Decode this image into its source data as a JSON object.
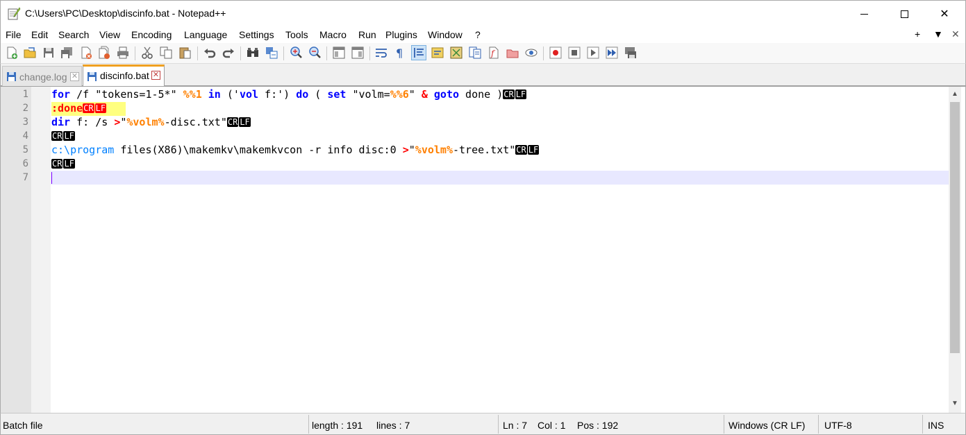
{
  "window": {
    "title": "C:\\Users\\PC\\Desktop\\discinfo.bat - Notepad++",
    "minimize": "minimize-icon",
    "maximize": "maximize-icon",
    "close": "✕"
  },
  "menu": {
    "items": [
      "File",
      "Edit",
      "Search",
      "View",
      "Encoding",
      "Language",
      "Settings",
      "Tools",
      "Macro",
      "Run",
      "Plugins",
      "Window",
      "?"
    ],
    "right": [
      "+",
      "▼",
      "✕"
    ]
  },
  "tabs": [
    {
      "label": "change.log",
      "active": false
    },
    {
      "label": "discinfo.bat",
      "active": true
    }
  ],
  "tab_close_glyph": "✕",
  "editor": {
    "line_numbers": [
      "1",
      "2",
      "3",
      "4",
      "5",
      "6",
      "7"
    ],
    "eol_cr": "CR",
    "eol_lf": "LF",
    "line1": {
      "kw_for": "for",
      "t1": " /f \"tokens=1-5*\" ",
      "var1": "%%1",
      "sp1": " ",
      "kw_in": "in",
      "t2": " ('",
      "kw_vol": "vol",
      "t3": " f:') ",
      "kw_do": "do",
      "t4": " ( ",
      "kw_set": "set",
      "t5": " \"volm=",
      "var2": "%%6",
      "t6": "\" ",
      "op_amp": "&",
      "sp2": " ",
      "kw_goto": "goto",
      "t7": " done )"
    },
    "line2": {
      "label": ":done"
    },
    "line3": {
      "kw_dir": "dir",
      "t1": " f: /s ",
      "op_gt": ">",
      "t2": "\"",
      "var": "%volm%",
      "t3": "-disc.txt\""
    },
    "line5": {
      "path": "c:\\program",
      "t1": " files(X86)\\makemkv\\makemkvcon -r info disc:0 ",
      "op_gt": ">",
      "t2": "\"",
      "var": "%volm%",
      "t3": "-tree.txt\""
    }
  },
  "scrollbar": {
    "up": "▲",
    "down": "▼"
  },
  "status": {
    "file_type": "Batch file",
    "length": "length : 191",
    "lines": "lines : 7",
    "ln": "Ln : 7",
    "col": "Col : 1",
    "pos": "Pos : 192",
    "eol": "Windows (CR LF)",
    "encoding": "UTF-8",
    "mode": "INS"
  },
  "toolbar": {
    "icons": [
      "new-file-icon",
      "open-file-icon",
      "save-icon",
      "save-all-icon",
      "close-icon",
      "close-all-icon",
      "print-icon",
      "cut-icon",
      "copy-icon",
      "paste-icon",
      "undo-icon",
      "redo-icon",
      "find-icon",
      "replace-icon",
      "zoom-in-icon",
      "zoom-out-icon",
      "sync-vertical-icon",
      "sync-horizontal-icon",
      "word-wrap-icon",
      "show-all-chars-icon",
      "indent-guide-icon",
      "user-defined-language-icon",
      "document-map-icon",
      "function-list-icon",
      "folder-as-workspace-icon",
      "document-list-icon",
      "monitoring-icon",
      "macro-record-icon",
      "macro-stop-icon",
      "macro-play-icon",
      "macro-run-multiple-icon",
      "macro-save-icon"
    ]
  }
}
